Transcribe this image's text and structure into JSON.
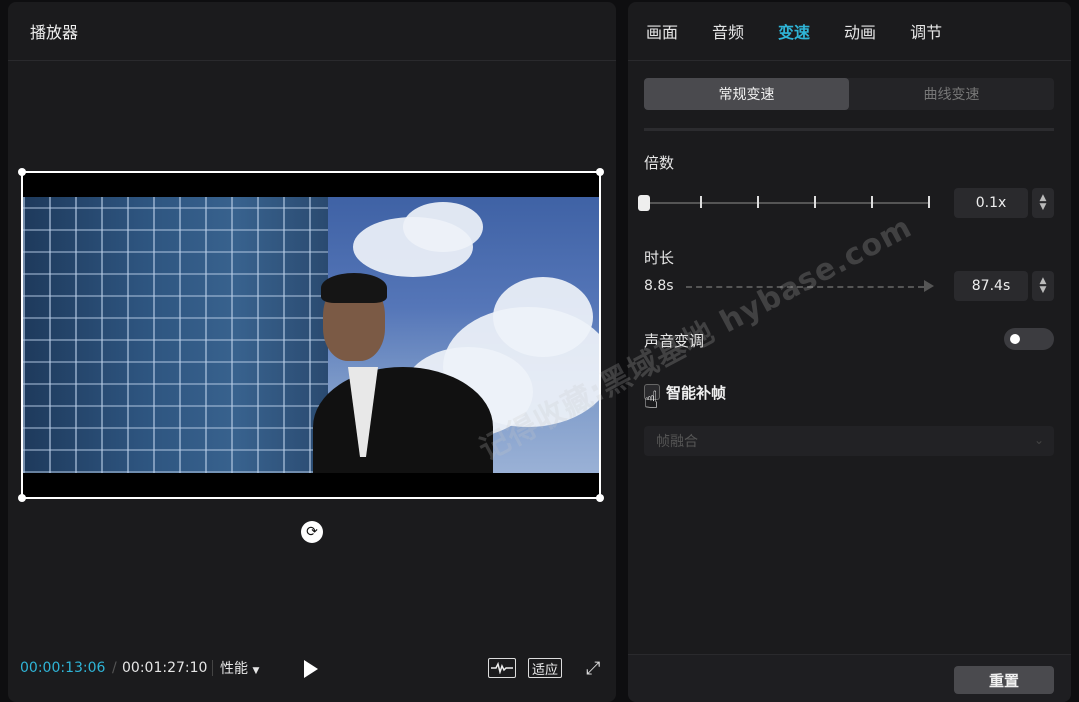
{
  "player": {
    "title": "播放器",
    "timecode_current": "00:00:13:06",
    "timecode_separator": "/",
    "timecode_total": "00:01:27:10",
    "performance_label": "性能",
    "fit_label": "适应"
  },
  "inspector": {
    "tabs": [
      "画面",
      "音频",
      "变速",
      "动画",
      "调节"
    ],
    "active_tab": "变速",
    "speed_modes": [
      "常规变速",
      "曲线变速"
    ],
    "multiplier_label": "倍数",
    "multiplier_value": "0.1x",
    "multiplier_level_fraction": 0,
    "duration_label": "时长",
    "duration_original": "8.8s",
    "duration_value": "87.4s",
    "pitch_label": "声音变调",
    "pitch_enabled": false,
    "frame_interp_label": "智能补帧",
    "frame_interp_checked": false,
    "frame_method_value": "帧融合",
    "reset_label": "重置"
  },
  "watermark": "记得收藏:黑域基地 hybase.com",
  "colors": {
    "accent": "#2fb4d6",
    "panel_bg": "#1b1b1d",
    "app_bg": "#0e0e10"
  },
  "icons": [
    "rotate-icon",
    "play-icon",
    "waveform-icon",
    "fullscreen-icon",
    "dropdown-caret-icon",
    "stepper-icon",
    "chevron-down-icon",
    "hand-cursor-icon"
  ]
}
